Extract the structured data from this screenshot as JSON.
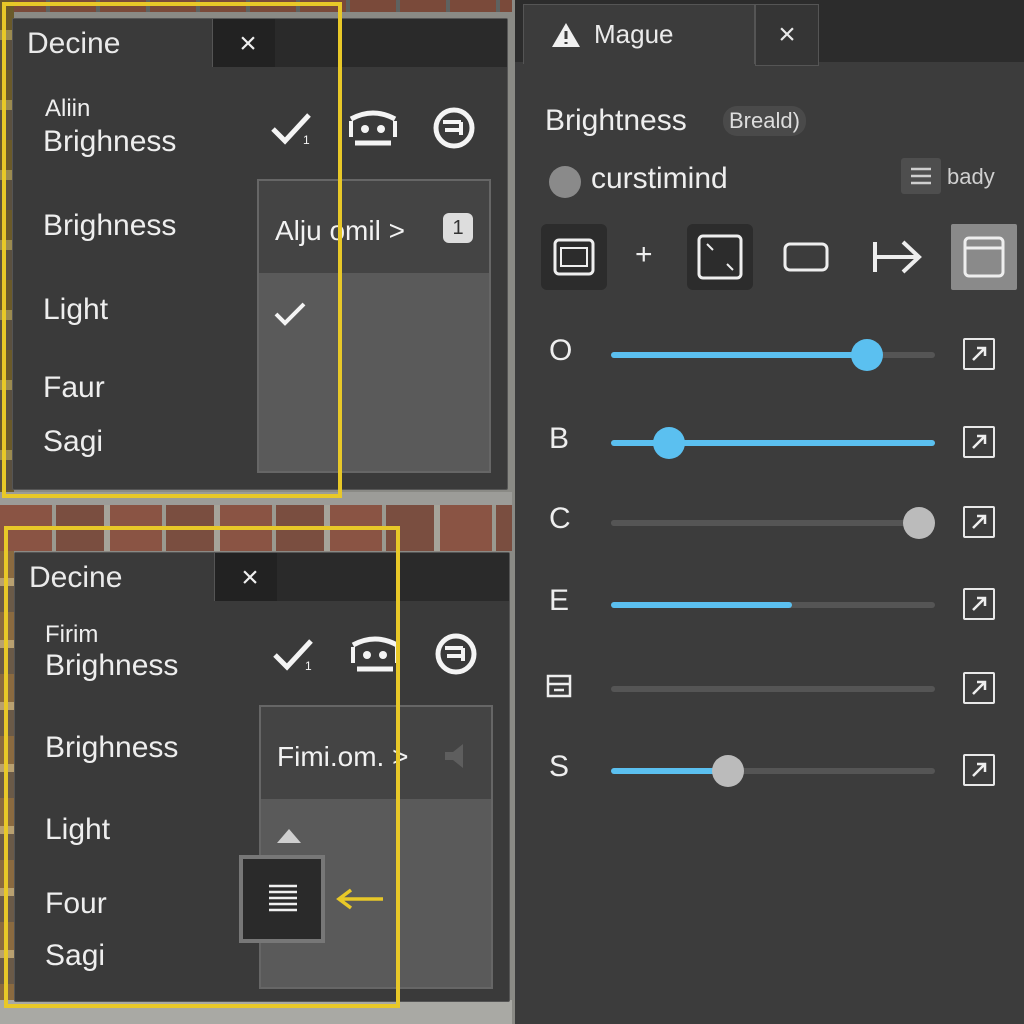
{
  "panel_top": {
    "tab_title": "Decine",
    "close": "×",
    "header_small": "Aliin",
    "header_main": "Brighness",
    "items": [
      "Brighness",
      "Light",
      "Faur",
      "Sagi"
    ],
    "dropdown_label": "Alju  omil >",
    "dropdown_badge": "1",
    "check_subscript": "1"
  },
  "panel_bottom": {
    "tab_title": "Decine",
    "close": "×",
    "header_small": "Firim",
    "header_main": "Brighness",
    "items": [
      "Brighness",
      "Light",
      "Four",
      "Sagi"
    ],
    "dropdown_label": "Fimi.om. >",
    "check_subscript": "1"
  },
  "right_panel": {
    "tab_title": "Mague",
    "close": "×",
    "title": "Brightness",
    "title_badge": "Breald)",
    "subtitle": "curstimind",
    "chip_label": "bady",
    "plus": "+",
    "sliders": [
      {
        "label": "O",
        "value": 0.79,
        "fill": "#5bc0f0",
        "knob": "#5bc0f0",
        "show_knob": true
      },
      {
        "label": "B",
        "value": 0.18,
        "fill": "#5bc0f0",
        "knob": "#5bc0f0",
        "show_knob": true,
        "full_fill": true
      },
      {
        "label": "C",
        "value": 0.95,
        "fill": "#555555",
        "knob": "#bbbbbb",
        "show_knob": true
      },
      {
        "label": "E",
        "value": 0.56,
        "fill": "#5bc0f0",
        "knob": "#5bc0f0",
        "show_knob": false
      },
      {
        "label": "",
        "value": 0.0,
        "fill": "#555555",
        "knob": "#888888",
        "show_knob": false
      },
      {
        "label": "S",
        "value": 0.36,
        "fill": "#5bc0f0",
        "knob": "#bbbbbb",
        "show_knob": true
      }
    ]
  },
  "colors": {
    "accent": "#5bc0f0",
    "highlight": "#e8c828",
    "panel": "#3a3a3a"
  }
}
